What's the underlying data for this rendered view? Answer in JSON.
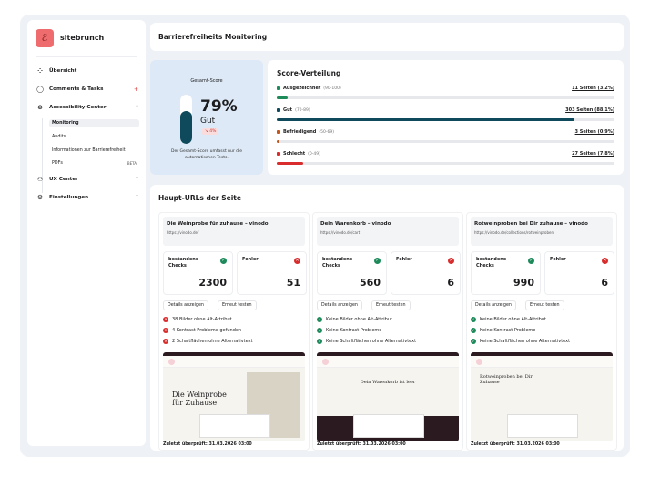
{
  "sidebar": {
    "brand": "sitebrunch",
    "items": [
      {
        "label": "Übersicht",
        "icon": "grid-icon"
      },
      {
        "label": "Comments & Tasks",
        "icon": "chat-icon",
        "badge": "+"
      },
      {
        "label": "Accessibility Center",
        "icon": "accessibility-icon"
      },
      {
        "label": "UX Center",
        "icon": "users-icon"
      },
      {
        "label": "Einstellungen",
        "icon": "gear-icon"
      }
    ],
    "subitems": [
      {
        "label": "Monitoring",
        "active": true
      },
      {
        "label": "Audits"
      },
      {
        "label": "Informationen zur Barrierefreiheit"
      },
      {
        "label": "PDFs",
        "badge": "BETA"
      }
    ]
  },
  "header": {
    "title": "Barrierefreiheits Monitoring"
  },
  "score": {
    "label": "Gesamt-Score",
    "value": "79%",
    "percent": 79,
    "grade": "Gut",
    "trend": "↘ 4%",
    "note": "Der Gesamt-Score umfasst nur die automatischen Tests."
  },
  "distribution": {
    "title": "Score-Verteilung",
    "rows": [
      {
        "label": "Ausgezeichnet",
        "range": "(90-100)",
        "count": "11 Seiten (3.2%)",
        "percent": 3.2,
        "color": "#1d8a5a"
      },
      {
        "label": "Gut",
        "range": "(70-89)",
        "count": "303 Seiten (88.1%)",
        "percent": 88.1,
        "color": "#0f4a5c"
      },
      {
        "label": "Befriedigend",
        "range": "(50-69)",
        "count": "3 Seiten (0.9%)",
        "percent": 0.9,
        "color": "#c0561b"
      },
      {
        "label": "Schlecht",
        "range": "(0-49)",
        "count": "27 Seiten (7.8%)",
        "percent": 7.8,
        "color": "#d92c2c"
      }
    ]
  },
  "urls": {
    "title": "Haupt-URLs der Seite",
    "passed_label": "bestandene Checks",
    "errors_label": "Fehler",
    "details_label": "Details anzeigen",
    "retest_label": "Erneut testen",
    "cards": [
      {
        "title": "Die Weinprobe für zuhause – vinodo",
        "url": "https://vinodo.de/",
        "passed": "2300",
        "errors": "51",
        "checks": [
          {
            "text": "38 Bilder ohne Alt-Attribut",
            "ok": false
          },
          {
            "text": "4 Kontrast Probleme gefunden",
            "ok": false
          },
          {
            "text": "2 Schaltflächen ohne Alternativtext",
            "ok": false
          }
        ],
        "shot_heading": "Die Weinprobe für Zuhause",
        "last": "Zuletzt überprüft: 31.03.2026 03:00"
      },
      {
        "title": "Dein Warenkorb – vinodo",
        "url": "https://vinodo.de/cart",
        "passed": "560",
        "errors": "6",
        "checks": [
          {
            "text": "Keine Bilder ohne Alt-Attribut",
            "ok": true
          },
          {
            "text": "Keine Kontrast Probleme",
            "ok": true
          },
          {
            "text": "Keine Schaltflächen ohne Alternativtext",
            "ok": true
          }
        ],
        "shot_heading": "Dein Warenkorb ist leer",
        "last": "Zuletzt überprüft: 31.03.2026 03:00"
      },
      {
        "title": "Rotweinproben bei Dir zuhause – vinodo",
        "url": "https://vinodo.de/collections/rotweinproben",
        "passed": "990",
        "errors": "6",
        "checks": [
          {
            "text": "Keine Bilder ohne Alt-Attribut",
            "ok": true
          },
          {
            "text": "Keine Kontrast Probleme",
            "ok": true
          },
          {
            "text": "Keine Schaltflächen ohne Alternativtext",
            "ok": true
          }
        ],
        "shot_heading": "Rotweinproben bei Dir Zuhause",
        "last": "Zuletzt überprüft: 31.03.2026 03:00"
      }
    ]
  }
}
